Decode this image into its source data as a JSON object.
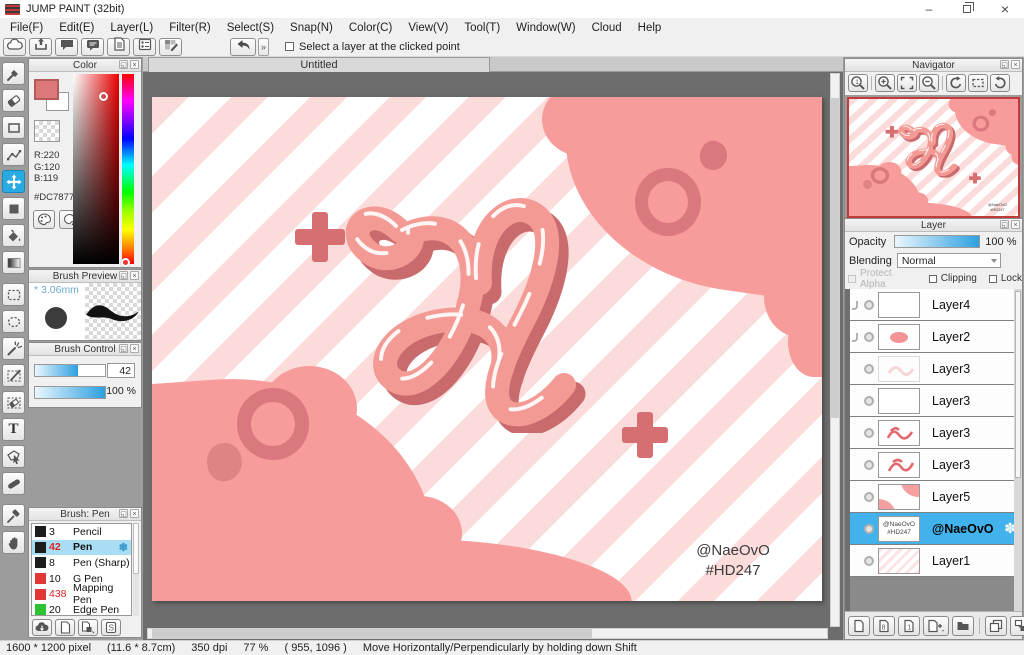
{
  "window": {
    "title": "JUMP PAINT (32bit)",
    "minimize_glyph": "–",
    "close_glyph": "×"
  },
  "menu": {
    "items": [
      "File(F)",
      "Edit(E)",
      "Layer(L)",
      "Filter(R)",
      "Select(S)",
      "Snap(N)",
      "Color(C)",
      "View(V)",
      "Tool(T)",
      "Window(W)",
      "Cloud",
      "Help"
    ]
  },
  "quickbar": {
    "icons": [
      "cloud",
      "share",
      "comment",
      "chat-panel",
      "document",
      "form",
      "palette-edit"
    ],
    "undo_icon": "undo-arrow",
    "overflow_glyph": "»",
    "select_layer_label": "Select a layer at the clicked point"
  },
  "tools": {
    "names": [
      "brush",
      "eraser",
      "shape-rect",
      "polyline",
      "move",
      "fill-square",
      "bucket-fill",
      "gradient",
      "select-rect",
      "select-lasso",
      "magic-wand",
      "select-pen",
      "select-eraser",
      "text",
      "operation",
      "divide",
      "eyedropper",
      "hand"
    ],
    "active": "move",
    "text_tool_glyph": "T"
  },
  "color_panel": {
    "title": "Color",
    "rgb_label": "R:220\nG:120\nB:119",
    "hex_label": "#DC7877",
    "foreground_hex": "#DC7877"
  },
  "brush_preview": {
    "title": "Brush Preview",
    "size_label": "* 3.06mm"
  },
  "brush_control": {
    "title": "Brush Control",
    "size_value": "42",
    "opacity_value": "100 %"
  },
  "brush_panel": {
    "title": "Brush: Pen",
    "selected": "Pen",
    "gear_glyph": "✽",
    "rows": [
      {
        "size": "3",
        "name": "Pencil"
      },
      {
        "size": "42",
        "name": "Pen"
      },
      {
        "size": "8",
        "name": "Pen (Sharp)"
      },
      {
        "size": "10",
        "name": "G Pen"
      },
      {
        "size": "438",
        "name": "Mapping Pen"
      },
      {
        "size": "20",
        "name": "Edge Pen"
      }
    ]
  },
  "document": {
    "tab": "Untitled",
    "signature_line1": "@NaeOvO",
    "signature_line2": "#HD247"
  },
  "navigator": {
    "title": "Navigator",
    "buttons": [
      "zoom-100",
      "zoom-in",
      "fit-screen",
      "zoom-out",
      "rotate-left",
      "reset-rotation",
      "rotate-right"
    ]
  },
  "layer_panel": {
    "title": "Layer",
    "opacity_label": "Opacity",
    "opacity_value": "100 %",
    "blending_label": "Blending",
    "blending_value": "Normal",
    "protect_alpha_label": "Protect Alpha",
    "clipping_label": "Clipping",
    "lock_label": "Lock",
    "selected": "@NaeOvO",
    "gear_glyph": "✽",
    "thumb_sig_line1": "@NaeOvO",
    "thumb_sig_line2": "#HD247",
    "rows": [
      {
        "name": "Layer4"
      },
      {
        "name": "Layer2"
      },
      {
        "name": "Layer3"
      },
      {
        "name": "Layer3"
      },
      {
        "name": "Layer3"
      },
      {
        "name": "Layer3"
      },
      {
        "name": "Layer5"
      },
      {
        "name": "@NaeOvO"
      },
      {
        "name": "Layer1"
      }
    ]
  },
  "status_bar": {
    "size": "1600 * 1200 pixel",
    "dimensions": "(11.6 * 8.7cm)",
    "dpi": "350 dpi",
    "zoom": "77 %",
    "cursor": "( 955, 1096 )",
    "hint": "Move Horizontally/Perpendicularly by holding down Shift"
  },
  "colors": {
    "accent_blue": "#42b2ec",
    "selection_light_blue": "#a9ddf3",
    "foreground": "#DC7877",
    "salmon": "#f89b9b",
    "rose": "#d9797d",
    "stripe_pink": "#fbdcdb",
    "canvas_gray": "#6d6d6d"
  }
}
